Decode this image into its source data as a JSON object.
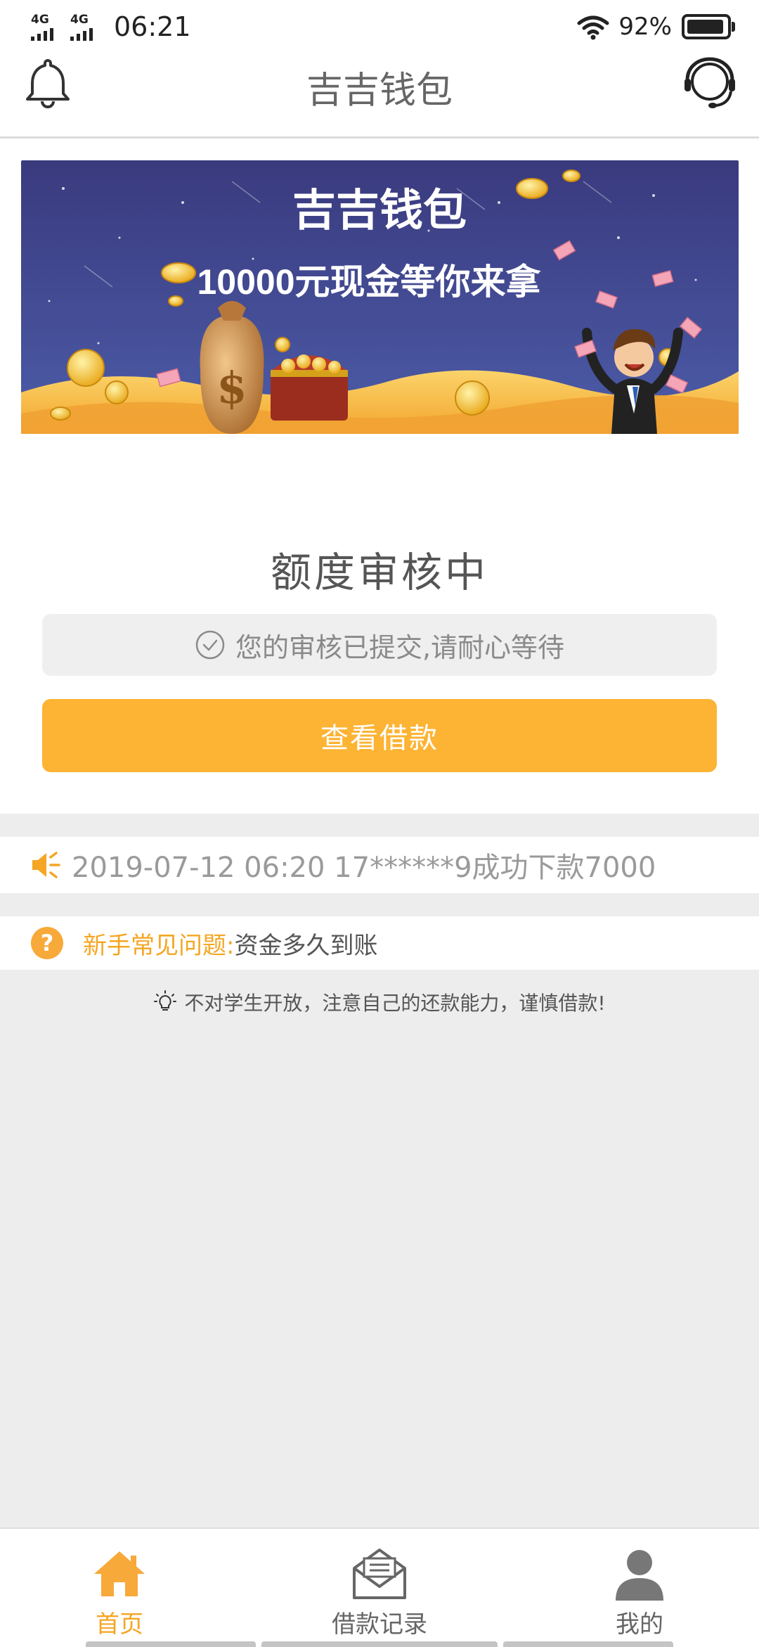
{
  "status_bar": {
    "network_1": "4G",
    "network_2": "4G",
    "time": "06:21",
    "battery_percent": "92%",
    "icons": [
      "signal-icon",
      "wifi-icon",
      "battery-icon"
    ]
  },
  "header": {
    "title": "吉吉钱包",
    "left_icon": "bell-icon",
    "right_icon": "customer-service-icon"
  },
  "banner": {
    "title": "吉吉钱包",
    "subtitle": "10000元现金等你来拿"
  },
  "review": {
    "status_title": "额度审核中",
    "notice": "您的审核已提交,请耐心等待",
    "button_label": "查看借款"
  },
  "ticker": {
    "text": "2019-07-12 06:20 17******9成功下款7000"
  },
  "faq": {
    "label": "新手常见问题:",
    "value": "资金多久到账"
  },
  "warning": {
    "text": "不对学生开放，注意自己的还款能力，谨慎借款!"
  },
  "bottom_nav": {
    "items": [
      {
        "label": "首页",
        "icon": "home-icon",
        "active": true
      },
      {
        "label": "借款记录",
        "icon": "mail-icon",
        "active": false
      },
      {
        "label": "我的",
        "icon": "user-icon",
        "active": false
      }
    ]
  },
  "colors": {
    "accent": "#fdb333",
    "faq_label": "#f5a623",
    "page_bg": "#ededed",
    "banner_bg": "#3d3f86"
  }
}
